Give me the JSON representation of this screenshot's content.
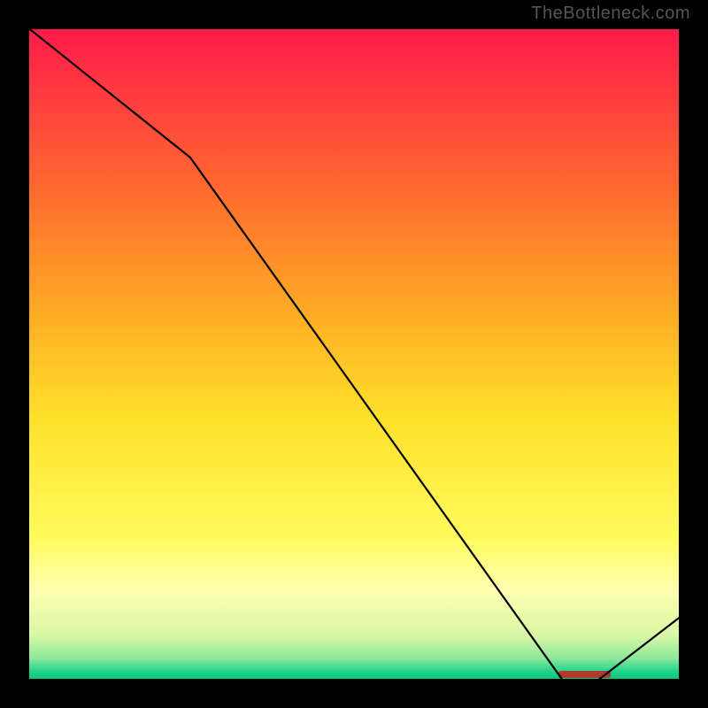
{
  "watermark": "TheBottleneck.com",
  "chart_data": {
    "type": "line",
    "title": "",
    "xlabel": "",
    "ylabel": "",
    "x": [
      0,
      0.25,
      0.82,
      0.87,
      1.0
    ],
    "values": [
      1.0,
      0.8,
      0.0,
      0.0,
      0.1
    ],
    "ylim": [
      0,
      1
    ],
    "xlim": [
      0,
      1
    ],
    "line_color": "#000000",
    "gradient_stops": [
      {
        "offset": 0.0,
        "color": "#ff1a4b"
      },
      {
        "offset": 0.25,
        "color": "#ff6a2f"
      },
      {
        "offset": 0.45,
        "color": "#ffb024"
      },
      {
        "offset": 0.6,
        "color": "#ffe12b"
      },
      {
        "offset": 0.78,
        "color": "#fffb5c"
      },
      {
        "offset": 0.86,
        "color": "#ffffb0"
      },
      {
        "offset": 0.93,
        "color": "#d8f7a6"
      },
      {
        "offset": 0.965,
        "color": "#8ae89a"
      },
      {
        "offset": 0.985,
        "color": "#1fd38a"
      },
      {
        "offset": 1.0,
        "color": "#06c47c"
      }
    ],
    "marker": {
      "color": "#b03a2e",
      "x": 0.82,
      "width_fraction": 0.08,
      "label": ""
    }
  }
}
